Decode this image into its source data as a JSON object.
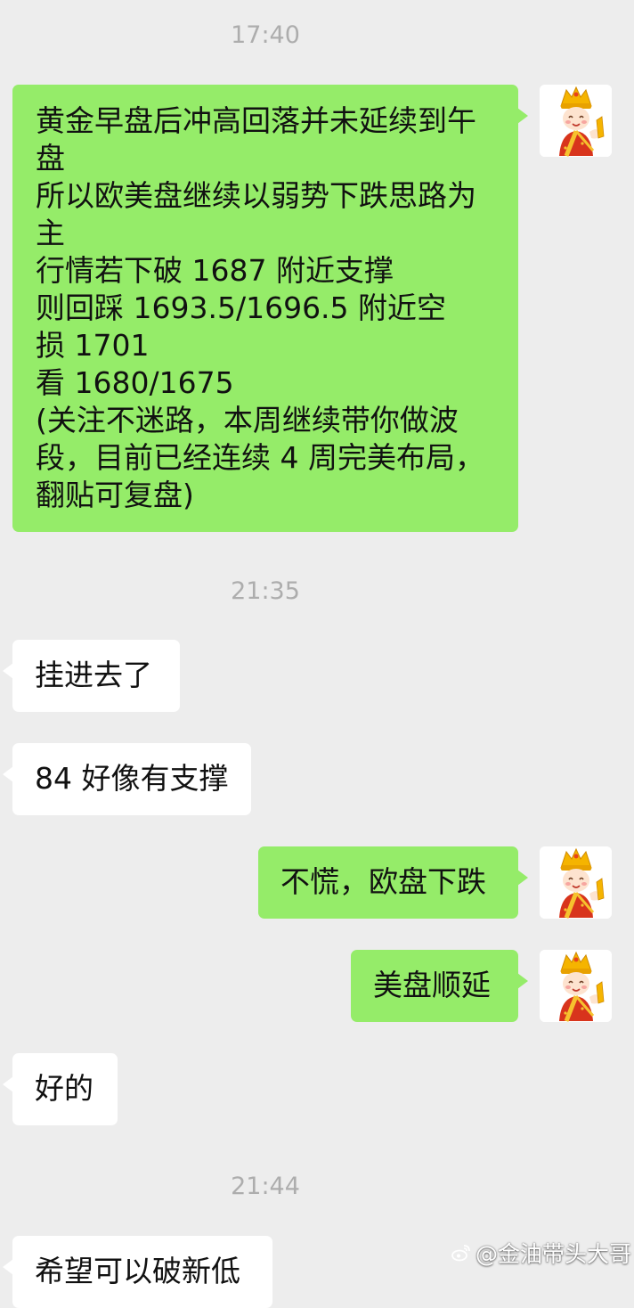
{
  "timestamps": [
    "17:40",
    "21:35",
    "21:44"
  ],
  "messages": [
    {
      "side": "out",
      "text": "黄金早盘后冲高回落并未延续到午\n盘\n所以欧美盘继续以弱势下跌思路为\n主\n行情若下破 1687 附近支撑\n则回踩 1693.5/1696.5 附近空\n损 1701\n看 1680/1675\n(关注不迷路，本周继续带你做波\n段，目前已经连续 4 周完美布局，\n翻贴可复盘)"
    },
    {
      "side": "in",
      "text": "挂进去了"
    },
    {
      "side": "in",
      "text": "84 好像有支撑"
    },
    {
      "side": "out",
      "text": "不慌，欧盘下跌"
    },
    {
      "side": "out",
      "text": "美盘顺延"
    },
    {
      "side": "in",
      "text": "好的"
    },
    {
      "side": "in",
      "text": "希望可以破新低"
    }
  ],
  "avatar": {
    "icon": "monk-cartoon-avatar-icon"
  },
  "watermark": {
    "icon": "weibo-logo-icon",
    "text": "@金油带头大哥"
  },
  "colors": {
    "background": "#ededed",
    "outgoing_bubble": "#95ec69",
    "incoming_bubble": "#ffffff",
    "timestamp": "#adadad",
    "text": "#111111"
  }
}
